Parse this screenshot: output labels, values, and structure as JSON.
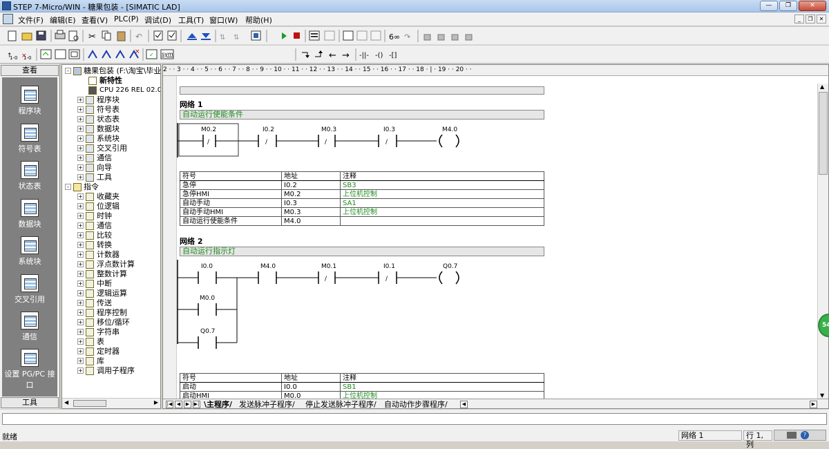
{
  "window": {
    "title": "STEP 7-Micro/WIN - 糖果包装 - [SIMATIC LAD]"
  },
  "menu": [
    "文件(F)",
    "编辑(E)",
    "查看(V)",
    "PLC(P)",
    "调试(D)",
    "工具(T)",
    "窗口(W)",
    "帮助(H)"
  ],
  "toolbar2": {
    "sym_label": "sym"
  },
  "nav": {
    "header": "查看",
    "footer": "工具",
    "items": [
      "程序块",
      "符号表",
      "状态表",
      "数据块",
      "系统块",
      "交叉引用",
      "通信",
      "设置 PG/PC 接口"
    ]
  },
  "tree": {
    "root": "糖果包装 (F:\\淘宝\\毕业",
    "new_features": "新特性",
    "cpu": "CPU 226 REL 02.01",
    "project_items": [
      "程序块",
      "符号表",
      "状态表",
      "数据块",
      "系统块",
      "交叉引用",
      "通信",
      "向导",
      "工具"
    ],
    "instructions_label": "指令",
    "instruction_items": [
      "收藏夹",
      "位逻辑",
      "时钟",
      "通信",
      "比较",
      "转换",
      "计数器",
      "浮点数计算",
      "整数计算",
      "中断",
      "逻辑运算",
      "传送",
      "程序控制",
      "移位/循环",
      "字符串",
      "表",
      "定时器",
      "库",
      "调用子程序"
    ]
  },
  "ruler": "2 · · 3 · · 4 · · 5 · · 6 · · 7 · · 8 · · 9 · · 10 · · 11 · · 12 · · 13 · · 14 · · 15 · · 16 · · 17 · · 18 · | · 19 · · 20 · ·",
  "networks": [
    {
      "title": "网络 1",
      "comment": "自动运行使能条件",
      "contacts": [
        "M0.2",
        "I0.2",
        "M0.3",
        "I0.3"
      ],
      "coil": "M4.0",
      "table_header": [
        "符号",
        "地址",
        "注释"
      ],
      "rows": [
        [
          "急停",
          "I0.2",
          "SB3"
        ],
        [
          "急停HMI",
          "M0.2",
          "上位机控制"
        ],
        [
          "自动手动",
          "I0.3",
          "SA1"
        ],
        [
          "自动手动HMI",
          "M0.3",
          "上位机控制"
        ],
        [
          "自动运行使能条件",
          "M4.0",
          ""
        ]
      ]
    },
    {
      "title": "网络 2",
      "comment": "自动运行指示灯",
      "contacts": [
        "I0.0",
        "M4.0",
        "M0.1",
        "I0.1"
      ],
      "parallel": [
        "M0.0",
        "Q0.7"
      ],
      "coil": "Q0.7",
      "table_header": [
        "符号",
        "地址",
        "注释"
      ],
      "rows": [
        [
          "启动",
          "I0.0",
          "SB1"
        ],
        [
          "启动HMI",
          "M0.0",
          "上位机控制"
        ]
      ]
    }
  ],
  "tabs": [
    "主程序",
    "发送脉冲子程序",
    "停止发送脉冲子程序",
    "自动动作步骤程序"
  ],
  "status": {
    "ready": "就绪",
    "network": "网络 1",
    "position": "行 1, 列"
  },
  "bubble": "54"
}
